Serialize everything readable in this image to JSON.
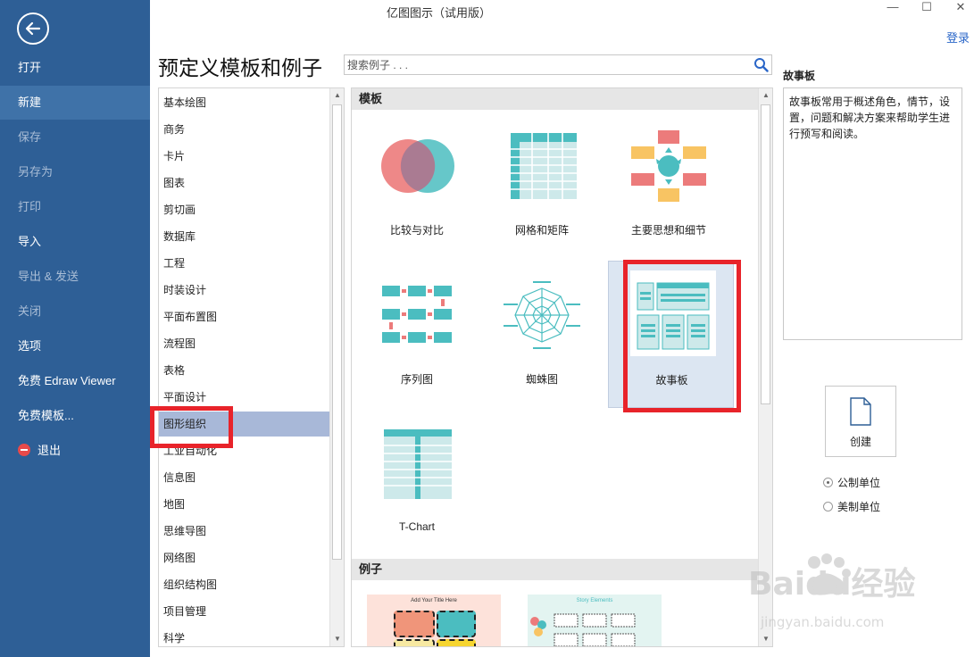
{
  "window": {
    "title": "亿图图示（试用版）",
    "minimize": "—",
    "maximize": "☐",
    "close": "✕",
    "login": "登录"
  },
  "sidebar": {
    "back_icon": "back-arrow-icon",
    "items": [
      {
        "label": "打开",
        "state": "normal"
      },
      {
        "label": "新建",
        "state": "active"
      },
      {
        "label": "保存",
        "state": "disabled"
      },
      {
        "label": "另存为",
        "state": "disabled"
      },
      {
        "label": "打印",
        "state": "disabled"
      },
      {
        "label": "导入",
        "state": "normal"
      },
      {
        "label": "导出 & 发送",
        "state": "disabled"
      },
      {
        "label": "关闭",
        "state": "disabled"
      },
      {
        "label": "选项",
        "state": "normal"
      },
      {
        "label": "免费 Edraw Viewer",
        "state": "normal"
      },
      {
        "label": "免费模板...",
        "state": "normal"
      },
      {
        "label": "退出",
        "state": "normal",
        "icon": "exit-icon"
      }
    ]
  },
  "main": {
    "heading": "预定义模板和例子",
    "search": {
      "placeholder": "搜索例子 . . ."
    }
  },
  "categories": {
    "selected": "图形组织",
    "items": [
      "基本绘图",
      "商务",
      "卡片",
      "图表",
      "剪切画",
      "数据库",
      "工程",
      "时装设计",
      "平面布置图",
      "流程图",
      "表格",
      "平面设计",
      "图形组织",
      "工业自动化",
      "信息图",
      "地图",
      "思维导图",
      "网络图",
      "组织结构图",
      "项目管理",
      "科学"
    ]
  },
  "templates": {
    "section_title": "模板",
    "items": [
      {
        "label": "比较与对比",
        "icon": "venn-diagram-icon"
      },
      {
        "label": "网格和矩阵",
        "icon": "grid-matrix-icon"
      },
      {
        "label": "主要思想和细节",
        "icon": "main-idea-icon"
      },
      {
        "label": "序列图",
        "icon": "sequence-chart-icon"
      },
      {
        "label": "蜘蛛图",
        "icon": "spider-diagram-icon"
      },
      {
        "label": "故事板",
        "icon": "storyboard-icon",
        "selected": true
      },
      {
        "label": "T-Chart",
        "icon": "t-chart-icon"
      }
    ]
  },
  "examples": {
    "section_title": "例子",
    "items": [
      {
        "caption": "Add Your Title Here"
      },
      {
        "caption": "Story Elements"
      }
    ]
  },
  "details": {
    "title": "故事板",
    "description": "故事板常用于概述角色，情节，设置，问题和解决方案来帮助学生进行预写和阅读。",
    "create_label": "创建",
    "units": [
      {
        "label": "公制单位",
        "checked": true
      },
      {
        "label": "美制单位",
        "checked": false
      }
    ]
  },
  "colors": {
    "sidebar": "#2e5f96",
    "accent_teal": "#4bbdc0",
    "accent_red": "#ec7b7b",
    "accent_yellow": "#f8c463",
    "highlight": "#e8232a"
  },
  "watermark": {
    "text": "Baidu经验",
    "subtext": "jingyan.baidu.com"
  }
}
